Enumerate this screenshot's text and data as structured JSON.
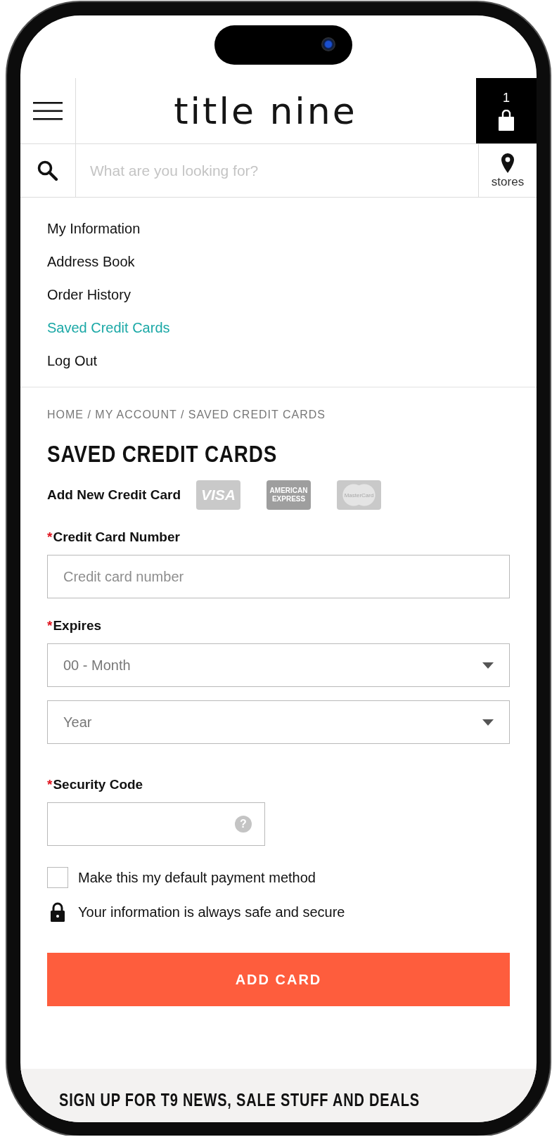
{
  "header": {
    "logo": "title nine",
    "cart_count": "1"
  },
  "search": {
    "placeholder": "What are you looking for?",
    "stores_label": "stores"
  },
  "account_menu": [
    {
      "label": "My Information",
      "selected": false
    },
    {
      "label": "Address Book",
      "selected": false
    },
    {
      "label": "Order History",
      "selected": false
    },
    {
      "label": "Saved Credit Cards",
      "selected": true
    },
    {
      "label": "Log Out",
      "selected": false
    }
  ],
  "breadcrumb": "HOME / MY ACCOUNT / SAVED CREDIT CARDS",
  "page_title": "SAVED CREDIT CARDS",
  "add_card": {
    "label": "Add New Credit Card",
    "card_logos": [
      {
        "kind": "visa",
        "text": "VISA"
      },
      {
        "kind": "amex",
        "text": "AMERICAN EXPRESS"
      },
      {
        "kind": "mastercard",
        "text": "MasterCard"
      }
    ]
  },
  "fields": [
    {
      "kind": "text",
      "marker": "*",
      "label": "Credit Card Number",
      "placeholder": "Credit card number"
    },
    {
      "kind": "select",
      "marker": "*",
      "label": "Expires",
      "value": "00 - Month"
    },
    {
      "kind": "select",
      "value": "Year"
    },
    {
      "kind": "security",
      "marker": "*",
      "label": "Security Code",
      "help": "?"
    }
  ],
  "default_checkbox": {
    "label": "Make this my default payment method",
    "checked": false
  },
  "secure_note": "Your information is always safe and secure",
  "submit": "ADD CARD",
  "footer": "SIGN UP FOR T9 NEWS, SALE STUFF AND DEALS"
}
